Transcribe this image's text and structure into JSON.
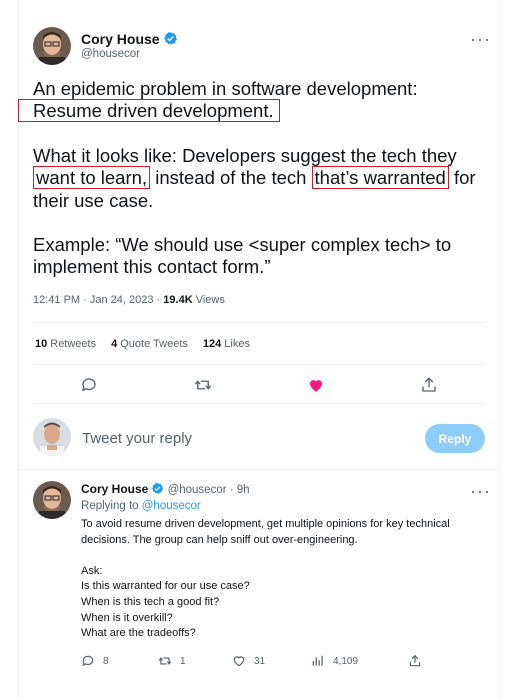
{
  "tweet": {
    "author_name": "Cory House",
    "author_handle": "@housecor",
    "text_line1": "An epidemic problem in software development:",
    "text_highlight1": "Resume driven development.",
    "text_p2_a": "What it looks like: Developers suggest the tech they",
    "text_p2_hl1": "want to learn,",
    "text_p2_b": " instead of the tech ",
    "text_p2_hl2": "that’s warranted",
    "text_p2_c": " for",
    "text_p2_d": "their use case.",
    "text_p3": "Example: “We should use <super complex tech> to implement this contact form.”",
    "time": "12:41 PM",
    "date": "Jan 24, 2023",
    "views_count": "19.4K",
    "views_label": "Views",
    "retweets_count": "10",
    "retweets_label": "Retweets",
    "quotes_count": "4",
    "quotes_label": "Quote Tweets",
    "likes_count": "124",
    "likes_label": "Likes",
    "liked": true,
    "like_color": "#f91880"
  },
  "compose": {
    "placeholder": "Tweet your reply",
    "reply_button": "Reply"
  },
  "reply": {
    "author_name": "Cory House",
    "author_handle": "@housecor",
    "age": "9h",
    "replying_prefix": "Replying to",
    "replying_handle": "@housecor",
    "line1": "To avoid resume driven development, get multiple opinions for key technical",
    "line2": "decisions. The group can help sniff out over-engineering.",
    "ask": "Ask:",
    "q1": "Is this warranted for our use case?",
    "q2": "When is this tech a good fit?",
    "q3": "When is it overkill?",
    "q4": "What are the tradeoffs?",
    "replies": "8",
    "retweets": "1",
    "likes": "31",
    "views": "4,109"
  },
  "colors": {
    "accent": "#1d9bf0",
    "muted": "#536471",
    "highlight_box": "#d11a2a"
  },
  "icons": [
    "verified-badge-icon",
    "more-icon",
    "reply-icon",
    "retweet-icon",
    "like-icon",
    "share-icon",
    "views-icon"
  ]
}
